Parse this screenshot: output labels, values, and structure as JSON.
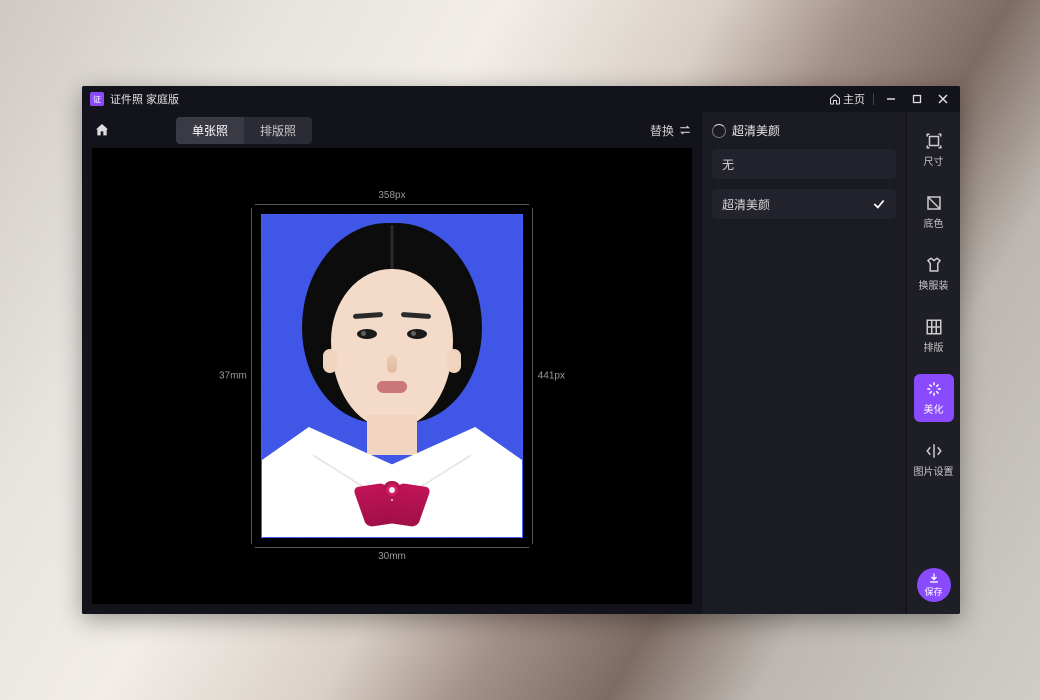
{
  "titlebar": {
    "app_name": "证件照 家庭版",
    "home_label": "主页"
  },
  "toolbar": {
    "tabs": [
      {
        "label": "单张照",
        "active": true
      },
      {
        "label": "排版照",
        "active": false
      }
    ],
    "replace_label": "替换"
  },
  "canvas": {
    "width_px": "358px",
    "height_px": "441px",
    "width_mm": "30mm",
    "height_mm": "37mm"
  },
  "inspector": {
    "section_title": "超清美颜",
    "options": [
      {
        "label": "无",
        "selected": false
      },
      {
        "label": "超清美颜",
        "selected": true
      }
    ]
  },
  "rail": {
    "items": [
      {
        "id": "size",
        "label": "尺寸"
      },
      {
        "id": "bgcolor",
        "label": "底色"
      },
      {
        "id": "clothes",
        "label": "换服装"
      },
      {
        "id": "layout",
        "label": "排版"
      },
      {
        "id": "beautify",
        "label": "美化",
        "active": true
      },
      {
        "id": "imgset",
        "label": "图片设置"
      }
    ],
    "save_label": "保存"
  }
}
